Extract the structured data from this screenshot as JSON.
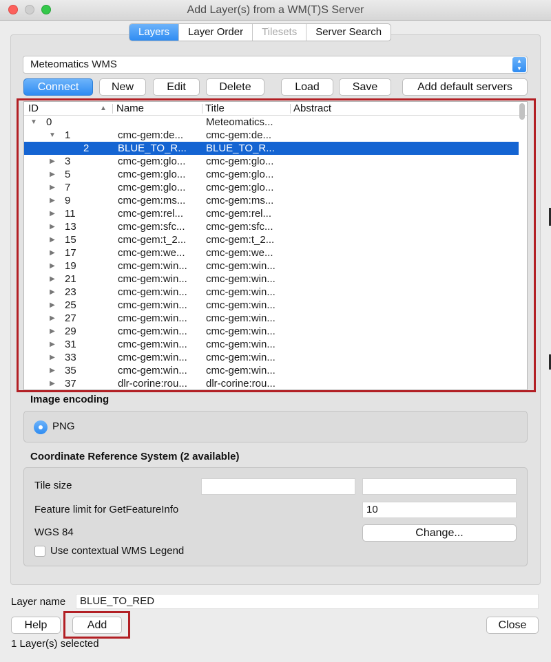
{
  "window": {
    "title": "Add Layer(s) from a WM(T)S Server"
  },
  "tabs": [
    {
      "label": "Layers",
      "state": "active"
    },
    {
      "label": "Layer Order",
      "state": "normal"
    },
    {
      "label": "Tilesets",
      "state": "disabled"
    },
    {
      "label": "Server Search",
      "state": "normal"
    }
  ],
  "server": {
    "selected": "Meteomatics WMS"
  },
  "buttons": {
    "connect": "Connect",
    "new": "New",
    "edit": "Edit",
    "delete": "Delete",
    "load": "Load",
    "save": "Save",
    "add_default": "Add default servers",
    "help": "Help",
    "add": "Add",
    "close": "Close",
    "change": "Change..."
  },
  "tree": {
    "columns": {
      "id": "ID",
      "name": "Name",
      "title": "Title",
      "abstract": "Abstract"
    },
    "rows": [
      {
        "id": "0",
        "name": "",
        "title": "Meteomatics...",
        "depth": 0,
        "expander": "expanded",
        "selected": false
      },
      {
        "id": "1",
        "name": "cmc-gem:de...",
        "title": "cmc-gem:de...",
        "depth": 1,
        "expander": "expanded",
        "selected": false
      },
      {
        "id": "2",
        "name": "BLUE_TO_R...",
        "title": "BLUE_TO_R...",
        "depth": 2,
        "expander": "none",
        "selected": true
      },
      {
        "id": "3",
        "name": "cmc-gem:glo...",
        "title": "cmc-gem:glo...",
        "depth": 1,
        "expander": "collapsed",
        "selected": false
      },
      {
        "id": "5",
        "name": "cmc-gem:glo...",
        "title": "cmc-gem:glo...",
        "depth": 1,
        "expander": "collapsed",
        "selected": false
      },
      {
        "id": "7",
        "name": "cmc-gem:glo...",
        "title": "cmc-gem:glo...",
        "depth": 1,
        "expander": "collapsed",
        "selected": false
      },
      {
        "id": "9",
        "name": "cmc-gem:ms...",
        "title": "cmc-gem:ms...",
        "depth": 1,
        "expander": "collapsed",
        "selected": false
      },
      {
        "id": "11",
        "name": "cmc-gem:rel...",
        "title": "cmc-gem:rel...",
        "depth": 1,
        "expander": "collapsed",
        "selected": false
      },
      {
        "id": "13",
        "name": "cmc-gem:sfc...",
        "title": "cmc-gem:sfc...",
        "depth": 1,
        "expander": "collapsed",
        "selected": false
      },
      {
        "id": "15",
        "name": "cmc-gem:t_2...",
        "title": "cmc-gem:t_2...",
        "depth": 1,
        "expander": "collapsed",
        "selected": false
      },
      {
        "id": "17",
        "name": "cmc-gem:we...",
        "title": "cmc-gem:we...",
        "depth": 1,
        "expander": "collapsed",
        "selected": false
      },
      {
        "id": "19",
        "name": "cmc-gem:win...",
        "title": "cmc-gem:win...",
        "depth": 1,
        "expander": "collapsed",
        "selected": false
      },
      {
        "id": "21",
        "name": "cmc-gem:win...",
        "title": "cmc-gem:win...",
        "depth": 1,
        "expander": "collapsed",
        "selected": false
      },
      {
        "id": "23",
        "name": "cmc-gem:win...",
        "title": "cmc-gem:win...",
        "depth": 1,
        "expander": "collapsed",
        "selected": false
      },
      {
        "id": "25",
        "name": "cmc-gem:win...",
        "title": "cmc-gem:win...",
        "depth": 1,
        "expander": "collapsed",
        "selected": false
      },
      {
        "id": "27",
        "name": "cmc-gem:win...",
        "title": "cmc-gem:win...",
        "depth": 1,
        "expander": "collapsed",
        "selected": false
      },
      {
        "id": "29",
        "name": "cmc-gem:win...",
        "title": "cmc-gem:win...",
        "depth": 1,
        "expander": "collapsed",
        "selected": false
      },
      {
        "id": "31",
        "name": "cmc-gem:win...",
        "title": "cmc-gem:win...",
        "depth": 1,
        "expander": "collapsed",
        "selected": false
      },
      {
        "id": "33",
        "name": "cmc-gem:win...",
        "title": "cmc-gem:win...",
        "depth": 1,
        "expander": "collapsed",
        "selected": false
      },
      {
        "id": "35",
        "name": "cmc-gem:win...",
        "title": "cmc-gem:win...",
        "depth": 1,
        "expander": "collapsed",
        "selected": false
      },
      {
        "id": "37",
        "name": "dlr-corine:rou...",
        "title": "dlr-corine:rou...",
        "depth": 1,
        "expander": "collapsed",
        "selected": false
      }
    ]
  },
  "image_encoding": {
    "label": "Image encoding",
    "option": "PNG",
    "selected": true
  },
  "crs": {
    "label": "Coordinate Reference System (2 available)",
    "tile_size_label": "Tile size",
    "tile_width": "",
    "tile_height": "",
    "feature_limit_label": "Feature limit for GetFeatureInfo",
    "feature_limit": "10",
    "crs_name": "WGS 84",
    "legend_label": "Use contextual WMS Legend",
    "legend_checked": false
  },
  "layer_name": {
    "label": "Layer name",
    "value": "BLUE_TO_RED"
  },
  "status": {
    "text": "1 Layer(s) selected"
  },
  "colors": {
    "accent": "#2f8cf2",
    "selection": "#1464d2",
    "highlight_box": "#b21f24"
  }
}
